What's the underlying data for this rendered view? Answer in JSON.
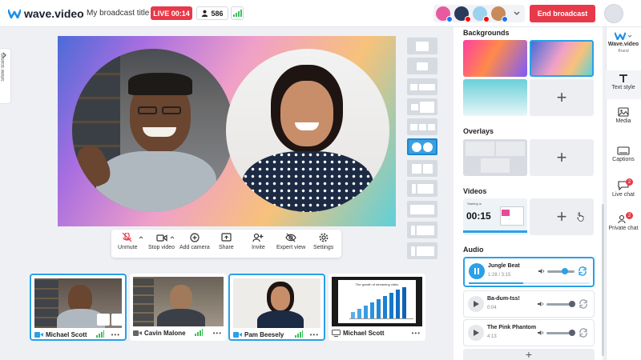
{
  "topbar": {
    "logo_text": "wave.video",
    "broadcast_title": "My broadcast title",
    "live_label": "LIVE 00:14",
    "viewer_count": "586",
    "end_button": "End broadcast"
  },
  "left": {
    "show_scenes": "Show scenes"
  },
  "controls": [
    {
      "label": "Unmute",
      "icon": "mic-off-icon"
    },
    {
      "label": "Stop video",
      "icon": "camera-icon"
    },
    {
      "label": "Add camera",
      "icon": "plus-circle-icon"
    },
    {
      "label": "Share",
      "icon": "share-screen-icon"
    },
    {
      "label": "Invite",
      "icon": "invite-icon"
    },
    {
      "label": "Expert view",
      "icon": "eye-off-icon"
    },
    {
      "label": "Settings",
      "icon": "gear-icon"
    }
  ],
  "participants": [
    {
      "name": "Michael Scott",
      "active": true
    },
    {
      "name": "Cavin Malone",
      "active": false
    },
    {
      "name": "Pam Beesely",
      "active": true
    },
    {
      "name": "Michael Scott",
      "active": false,
      "screen": true,
      "screen_title": "The growth of streaming video"
    }
  ],
  "panel": {
    "backgrounds_title": "Backgrounds",
    "overlays_title": "Overlays",
    "videos_title": "Videos",
    "video_time": "00:15",
    "video_caption": "Starting in",
    "audio_title": "Audio",
    "tracks": [
      {
        "title": "Jungle Beat",
        "time": "1:28 / 3:15",
        "active": true,
        "volume": 0.6
      },
      {
        "title": "Ba-dum-tss!",
        "time": "0:04",
        "active": false,
        "volume": 1.0
      },
      {
        "title": "The Pink Phantom",
        "time": "4:13",
        "active": false,
        "volume": 1.0
      }
    ]
  },
  "sidebar": {
    "brand_name": "Wave.video",
    "brand_sub": "Brand",
    "items": [
      {
        "label": "Text style",
        "icon": "text-icon"
      },
      {
        "label": "Media",
        "icon": "image-icon"
      },
      {
        "label": "Captions",
        "icon": "captions-icon"
      },
      {
        "label": "Live chat",
        "icon": "chat-icon",
        "badge": "2"
      },
      {
        "label": "Private chat",
        "icon": "private-chat-icon",
        "badge": "2"
      }
    ]
  },
  "colors": {
    "accent": "#2aa0e8",
    "live": "#e8394a",
    "signal": "#3cbf5a"
  }
}
